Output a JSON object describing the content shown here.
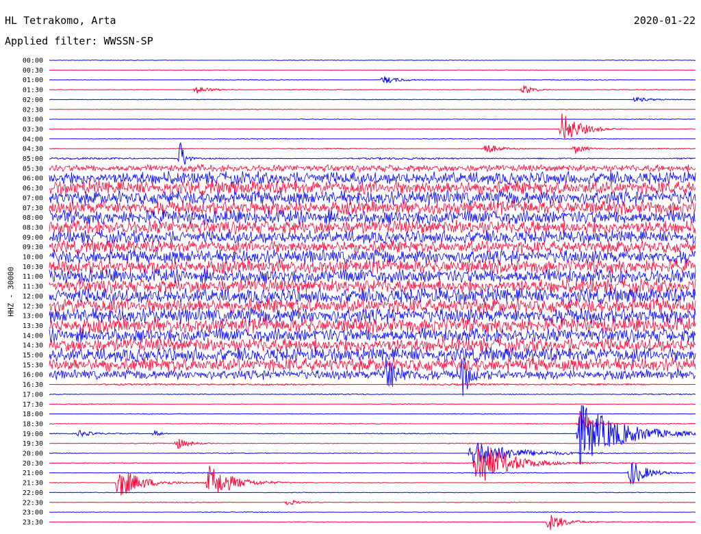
{
  "header": {
    "station": "HL Tetrakomo, Arta",
    "date": "2020-01-22",
    "filter": "Applied filter: WWSSN-SP"
  },
  "chart_data": {
    "type": "line",
    "title": "HL Tetrakomo, Arta",
    "subtitle": "Applied filter: WWSSN-SP",
    "ylabel": "HHZ - 30000",
    "xlabel": "",
    "row_labels": [
      "00:00",
      "00:30",
      "01:00",
      "01:30",
      "02:00",
      "02:30",
      "03:00",
      "03:30",
      "04:00",
      "04:30",
      "05:00",
      "05:30",
      "06:00",
      "06:30",
      "07:00",
      "07:30",
      "08:00",
      "08:30",
      "09:00",
      "09:30",
      "10:00",
      "10:30",
      "11:00",
      "11:30",
      "12:00",
      "12:30",
      "13:00",
      "13:30",
      "14:00",
      "14:30",
      "15:00",
      "15:30",
      "16:00",
      "16:30",
      "17:00",
      "17:30",
      "18:00",
      "18:30",
      "19:00",
      "19:30",
      "20:00",
      "20:30",
      "21:00",
      "21:30",
      "22:00",
      "22:30",
      "23:00",
      "23:30"
    ],
    "row_minutes": 30,
    "series_colors": [
      "#0000ff",
      "#ff0033"
    ],
    "noise_level": [
      0.5,
      0.5,
      0.6,
      0.6,
      0.6,
      0.5,
      0.5,
      0.6,
      0.7,
      0.8,
      1.5,
      6,
      11,
      12,
      12,
      12,
      12,
      12,
      11,
      11,
      12,
      12,
      12,
      12,
      13,
      13,
      13,
      13,
      12,
      12,
      12,
      12,
      8,
      1.5,
      0.8,
      0.6,
      0.6,
      0.7,
      0.8,
      0.7,
      0.7,
      0.7,
      0.7,
      0.7,
      0.6,
      0.6,
      0.6,
      0.6
    ],
    "events": [
      {
        "row": 2,
        "minute": 15.5,
        "amplitude": 6,
        "duration_min": 1.5
      },
      {
        "row": 3,
        "minute": 6.8,
        "amplitude": 6,
        "duration_min": 1.5
      },
      {
        "row": 3,
        "minute": 22.0,
        "amplitude": 8,
        "duration_min": 1.0
      },
      {
        "row": 4,
        "minute": 27.2,
        "amplitude": 4,
        "duration_min": 1.5
      },
      {
        "row": 7,
        "minute": 23.8,
        "amplitude": 24,
        "duration_min": 1.8
      },
      {
        "row": 9,
        "minute": 20.2,
        "amplitude": 9,
        "duration_min": 1.2
      },
      {
        "row": 9,
        "minute": 24.4,
        "amplitude": 7,
        "duration_min": 1.0
      },
      {
        "row": 10,
        "minute": 6.1,
        "amplitude": 30,
        "duration_min": 0.4
      },
      {
        "row": 32,
        "minute": 15.6,
        "amplitude": 26,
        "duration_min": 1.2
      },
      {
        "row": 32,
        "minute": 19.2,
        "amplitude": 32,
        "duration_min": 0.6
      },
      {
        "row": 37,
        "minute": 24.6,
        "amplitude": 24,
        "duration_min": 1.0
      },
      {
        "row": 38,
        "minute": 24.6,
        "amplitude": 46,
        "duration_min": 4.0
      },
      {
        "row": 38,
        "minute": 1.4,
        "amplitude": 5,
        "duration_min": 1.0
      },
      {
        "row": 38,
        "minute": 4.9,
        "amplitude": 5,
        "duration_min": 0.6
      },
      {
        "row": 39,
        "minute": 5.9,
        "amplitude": 9,
        "duration_min": 1.0
      },
      {
        "row": 40,
        "minute": 19.6,
        "amplitude": 22,
        "duration_min": 3.5
      },
      {
        "row": 41,
        "minute": 19.8,
        "amplitude": 38,
        "duration_min": 3.0
      },
      {
        "row": 42,
        "minute": 27.0,
        "amplitude": 22,
        "duration_min": 1.4
      },
      {
        "row": 43,
        "minute": 3.2,
        "amplitude": 24,
        "duration_min": 2.2
      },
      {
        "row": 43,
        "minute": 7.4,
        "amplitude": 26,
        "duration_min": 2.2
      },
      {
        "row": 45,
        "minute": 11.0,
        "amplitude": 5,
        "duration_min": 1.2
      },
      {
        "row": 47,
        "minute": 23.2,
        "amplitude": 14,
        "duration_min": 1.5
      }
    ]
  }
}
